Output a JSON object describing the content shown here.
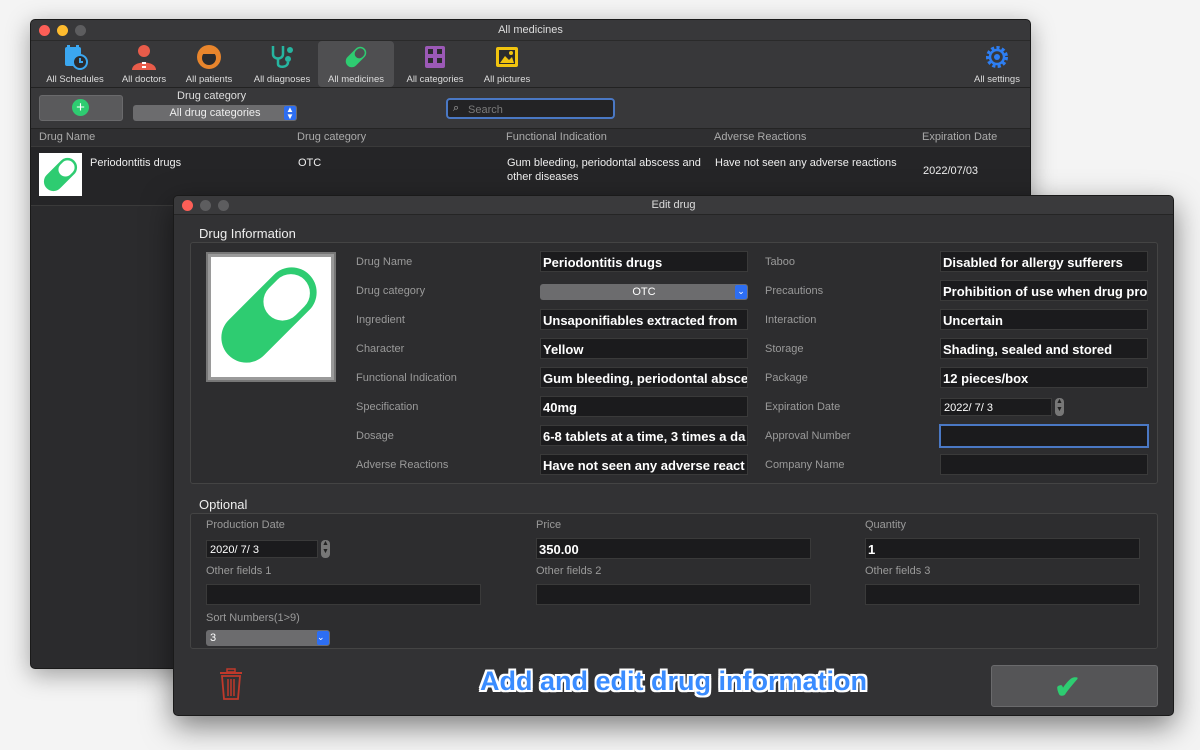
{
  "main_window": {
    "title": "All medicines",
    "toolbar": [
      {
        "label": "All Schedules",
        "icon": "calendar-clock-icon",
        "color": "#3ba7f0"
      },
      {
        "label": "All doctors",
        "icon": "doctor-icon",
        "color": "#e85c4a"
      },
      {
        "label": "All patients",
        "icon": "patient-icon",
        "color": "#e8852c"
      },
      {
        "label": "All diagnoses",
        "icon": "stethoscope-icon",
        "color": "#26b5a0"
      },
      {
        "label": "All medicines",
        "icon": "pill-icon",
        "color": "#2ecc71"
      },
      {
        "label": "All categories",
        "icon": "categories-icon",
        "color": "#9b59b6"
      },
      {
        "label": "All pictures",
        "icon": "pictures-icon",
        "color": "#f1c40f"
      },
      {
        "label": "All settings",
        "icon": "gear-icon",
        "color": "#2d7ef2"
      }
    ],
    "category_label": "Drug category",
    "category_value": "All drug categories",
    "search_placeholder": "Search",
    "table": {
      "columns": [
        "Drug Name",
        "Drug category",
        "Functional Indication",
        "Adverse Reactions",
        "Expiration Date"
      ],
      "rows": [
        {
          "name": "Periodontitis drugs",
          "category": "OTC",
          "indication_line1": "Gum bleeding, periodontal abscess and",
          "indication_line2": "other diseases",
          "adverse": "Have not seen any adverse reactions",
          "expiration": "2022/07/03"
        }
      ]
    }
  },
  "dialog": {
    "title": "Edit drug",
    "section_info": "Drug Information",
    "section_optional": "Optional",
    "left_fields": [
      {
        "label": "Drug Name",
        "value": "Periodontitis drugs"
      },
      {
        "label": "Drug category",
        "value": "OTC"
      },
      {
        "label": "Ingredient",
        "value": "Unsaponifiables extracted from"
      },
      {
        "label": "Character",
        "value": "Yellow"
      },
      {
        "label": "Functional Indication",
        "value": "Gum bleeding, periodontal absce"
      },
      {
        "label": "Specification",
        "value": "40mg"
      },
      {
        "label": "Dosage",
        "value": "6-8 tablets at a time, 3 times a da"
      },
      {
        "label": "Adverse Reactions",
        "value": "Have not seen any adverse react"
      }
    ],
    "right_fields": [
      {
        "label": "Taboo",
        "value": "Disabled for allergy sufferers"
      },
      {
        "label": "Precautions",
        "value": "Prohibition of use when drug pro"
      },
      {
        "label": "Interaction",
        "value": "Uncertain"
      },
      {
        "label": "Storage",
        "value": "Shading, sealed and stored"
      },
      {
        "label": "Package",
        "value": "12 pieces/box"
      },
      {
        "label": "Expiration Date",
        "value": "2022/  7/  3"
      },
      {
        "label": "Approval Number",
        "value": ""
      },
      {
        "label": "Company Name",
        "value": ""
      }
    ],
    "optional": {
      "production_date_label": "Production Date",
      "production_date": "2020/  7/  3",
      "price_label": "Price",
      "price": "350.00",
      "quantity_label": "Quantity",
      "quantity": "1",
      "other1_label": "Other fields 1",
      "other2_label": "Other fields 2",
      "other3_label": "Other fields 3",
      "sort_label": "Sort Numbers(1>9)",
      "sort_value": "3"
    },
    "caption": "Add and edit drug information",
    "accent_green": "#2ecc71",
    "delete_color": "#c0392b"
  }
}
